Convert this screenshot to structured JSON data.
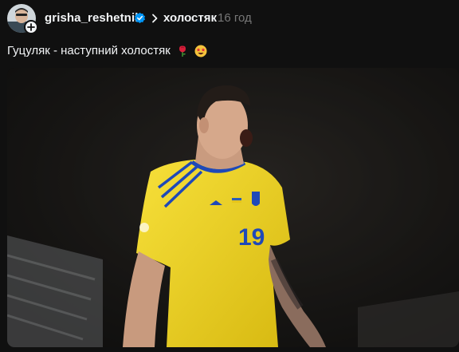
{
  "post": {
    "username": "grisha_reshetnik",
    "topic": "холостяк",
    "time": "16 год",
    "caption": "Гуцуляк - наступний холостяк",
    "caption_emojis": [
      "rose-emoji",
      "star-struck-emoji"
    ],
    "photo": {
      "shirt_number": "19",
      "jersey_color": "#f2d51a",
      "trim_color": "#1f49b8"
    }
  },
  "colors": {
    "background": "#101010",
    "text_primary": "#f3f5f7",
    "text_secondary": "#777777",
    "verified": "#0095f6"
  },
  "icons": [
    "avatar",
    "plus-icon",
    "verified-badge-icon",
    "chevron-right-icon"
  ]
}
